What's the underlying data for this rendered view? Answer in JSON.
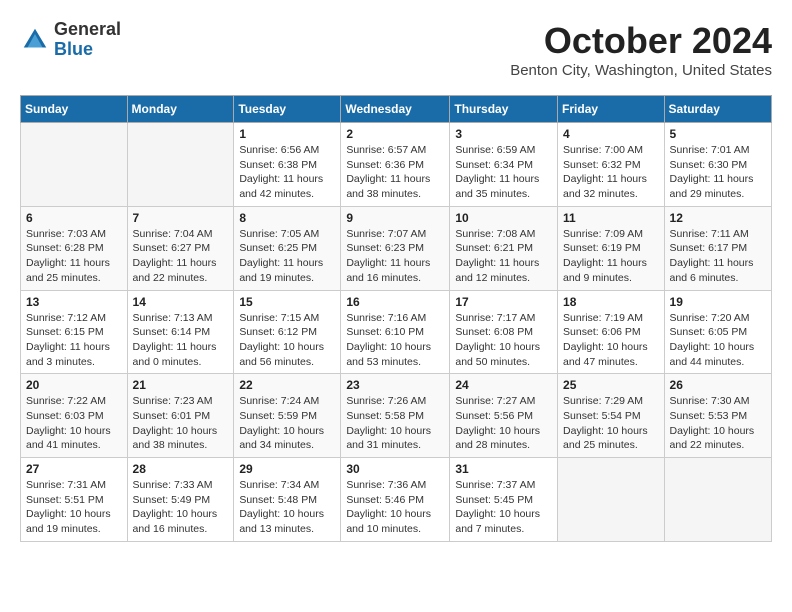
{
  "logo": {
    "general": "General",
    "blue": "Blue"
  },
  "title": "October 2024",
  "location": "Benton City, Washington, United States",
  "days_of_week": [
    "Sunday",
    "Monday",
    "Tuesday",
    "Wednesday",
    "Thursday",
    "Friday",
    "Saturday"
  ],
  "weeks": [
    [
      {
        "day": "",
        "sunrise": "",
        "sunset": "",
        "daylight": ""
      },
      {
        "day": "",
        "sunrise": "",
        "sunset": "",
        "daylight": ""
      },
      {
        "day": "1",
        "sunrise": "Sunrise: 6:56 AM",
        "sunset": "Sunset: 6:38 PM",
        "daylight": "Daylight: 11 hours and 42 minutes."
      },
      {
        "day": "2",
        "sunrise": "Sunrise: 6:57 AM",
        "sunset": "Sunset: 6:36 PM",
        "daylight": "Daylight: 11 hours and 38 minutes."
      },
      {
        "day": "3",
        "sunrise": "Sunrise: 6:59 AM",
        "sunset": "Sunset: 6:34 PM",
        "daylight": "Daylight: 11 hours and 35 minutes."
      },
      {
        "day": "4",
        "sunrise": "Sunrise: 7:00 AM",
        "sunset": "Sunset: 6:32 PM",
        "daylight": "Daylight: 11 hours and 32 minutes."
      },
      {
        "day": "5",
        "sunrise": "Sunrise: 7:01 AM",
        "sunset": "Sunset: 6:30 PM",
        "daylight": "Daylight: 11 hours and 29 minutes."
      }
    ],
    [
      {
        "day": "6",
        "sunrise": "Sunrise: 7:03 AM",
        "sunset": "Sunset: 6:28 PM",
        "daylight": "Daylight: 11 hours and 25 minutes."
      },
      {
        "day": "7",
        "sunrise": "Sunrise: 7:04 AM",
        "sunset": "Sunset: 6:27 PM",
        "daylight": "Daylight: 11 hours and 22 minutes."
      },
      {
        "day": "8",
        "sunrise": "Sunrise: 7:05 AM",
        "sunset": "Sunset: 6:25 PM",
        "daylight": "Daylight: 11 hours and 19 minutes."
      },
      {
        "day": "9",
        "sunrise": "Sunrise: 7:07 AM",
        "sunset": "Sunset: 6:23 PM",
        "daylight": "Daylight: 11 hours and 16 minutes."
      },
      {
        "day": "10",
        "sunrise": "Sunrise: 7:08 AM",
        "sunset": "Sunset: 6:21 PM",
        "daylight": "Daylight: 11 hours and 12 minutes."
      },
      {
        "day": "11",
        "sunrise": "Sunrise: 7:09 AM",
        "sunset": "Sunset: 6:19 PM",
        "daylight": "Daylight: 11 hours and 9 minutes."
      },
      {
        "day": "12",
        "sunrise": "Sunrise: 7:11 AM",
        "sunset": "Sunset: 6:17 PM",
        "daylight": "Daylight: 11 hours and 6 minutes."
      }
    ],
    [
      {
        "day": "13",
        "sunrise": "Sunrise: 7:12 AM",
        "sunset": "Sunset: 6:15 PM",
        "daylight": "Daylight: 11 hours and 3 minutes."
      },
      {
        "day": "14",
        "sunrise": "Sunrise: 7:13 AM",
        "sunset": "Sunset: 6:14 PM",
        "daylight": "Daylight: 11 hours and 0 minutes."
      },
      {
        "day": "15",
        "sunrise": "Sunrise: 7:15 AM",
        "sunset": "Sunset: 6:12 PM",
        "daylight": "Daylight: 10 hours and 56 minutes."
      },
      {
        "day": "16",
        "sunrise": "Sunrise: 7:16 AM",
        "sunset": "Sunset: 6:10 PM",
        "daylight": "Daylight: 10 hours and 53 minutes."
      },
      {
        "day": "17",
        "sunrise": "Sunrise: 7:17 AM",
        "sunset": "Sunset: 6:08 PM",
        "daylight": "Daylight: 10 hours and 50 minutes."
      },
      {
        "day": "18",
        "sunrise": "Sunrise: 7:19 AM",
        "sunset": "Sunset: 6:06 PM",
        "daylight": "Daylight: 10 hours and 47 minutes."
      },
      {
        "day": "19",
        "sunrise": "Sunrise: 7:20 AM",
        "sunset": "Sunset: 6:05 PM",
        "daylight": "Daylight: 10 hours and 44 minutes."
      }
    ],
    [
      {
        "day": "20",
        "sunrise": "Sunrise: 7:22 AM",
        "sunset": "Sunset: 6:03 PM",
        "daylight": "Daylight: 10 hours and 41 minutes."
      },
      {
        "day": "21",
        "sunrise": "Sunrise: 7:23 AM",
        "sunset": "Sunset: 6:01 PM",
        "daylight": "Daylight: 10 hours and 38 minutes."
      },
      {
        "day": "22",
        "sunrise": "Sunrise: 7:24 AM",
        "sunset": "Sunset: 5:59 PM",
        "daylight": "Daylight: 10 hours and 34 minutes."
      },
      {
        "day": "23",
        "sunrise": "Sunrise: 7:26 AM",
        "sunset": "Sunset: 5:58 PM",
        "daylight": "Daylight: 10 hours and 31 minutes."
      },
      {
        "day": "24",
        "sunrise": "Sunrise: 7:27 AM",
        "sunset": "Sunset: 5:56 PM",
        "daylight": "Daylight: 10 hours and 28 minutes."
      },
      {
        "day": "25",
        "sunrise": "Sunrise: 7:29 AM",
        "sunset": "Sunset: 5:54 PM",
        "daylight": "Daylight: 10 hours and 25 minutes."
      },
      {
        "day": "26",
        "sunrise": "Sunrise: 7:30 AM",
        "sunset": "Sunset: 5:53 PM",
        "daylight": "Daylight: 10 hours and 22 minutes."
      }
    ],
    [
      {
        "day": "27",
        "sunrise": "Sunrise: 7:31 AM",
        "sunset": "Sunset: 5:51 PM",
        "daylight": "Daylight: 10 hours and 19 minutes."
      },
      {
        "day": "28",
        "sunrise": "Sunrise: 7:33 AM",
        "sunset": "Sunset: 5:49 PM",
        "daylight": "Daylight: 10 hours and 16 minutes."
      },
      {
        "day": "29",
        "sunrise": "Sunrise: 7:34 AM",
        "sunset": "Sunset: 5:48 PM",
        "daylight": "Daylight: 10 hours and 13 minutes."
      },
      {
        "day": "30",
        "sunrise": "Sunrise: 7:36 AM",
        "sunset": "Sunset: 5:46 PM",
        "daylight": "Daylight: 10 hours and 10 minutes."
      },
      {
        "day": "31",
        "sunrise": "Sunrise: 7:37 AM",
        "sunset": "Sunset: 5:45 PM",
        "daylight": "Daylight: 10 hours and 7 minutes."
      },
      {
        "day": "",
        "sunrise": "",
        "sunset": "",
        "daylight": ""
      },
      {
        "day": "",
        "sunrise": "",
        "sunset": "",
        "daylight": ""
      }
    ]
  ]
}
